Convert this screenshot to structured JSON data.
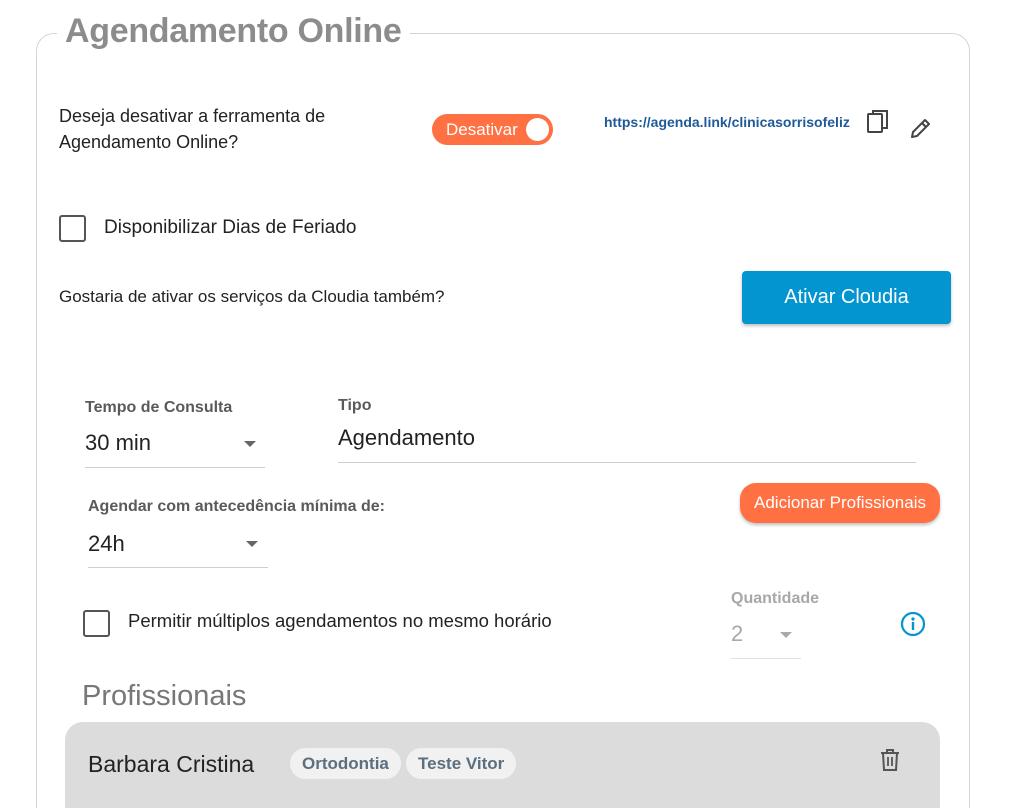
{
  "section": {
    "title": "Agendamento Online"
  },
  "disable_tool": {
    "question": "Deseja desativar a ferramenta de Agendamento Online?",
    "toggle_label": "Desativar",
    "link": "https://agenda.link/clinicasorrisofeliz"
  },
  "holidays": {
    "label": "Disponibilizar Dias de Feriado",
    "checked": false
  },
  "cloudia": {
    "question": "Gostaria de ativar os serviços da Cloudia também?",
    "button_label": "Ativar Cloudia"
  },
  "consulta": {
    "tempo_label": "Tempo de Consulta",
    "tempo_value": "30 min",
    "tipo_label": "Tipo",
    "tipo_value": "Agendamento"
  },
  "antecedencia": {
    "label": "Agendar com antecedência mínima de:",
    "value": "24h"
  },
  "add_prof_button": "Adicionar Profissionais",
  "multiplos": {
    "label": "Permitir múltiplos agendamentos no mesmo horário",
    "checked": false,
    "quantidade_label": "Quantidade",
    "quantidade_value": "2"
  },
  "profissionais": {
    "title": "Profissionais",
    "items": [
      {
        "name": "Barbara Cristina",
        "tags": [
          "Ortodontia",
          "Teste Vitor"
        ]
      }
    ]
  },
  "colors": {
    "accent_orange": "#ff7043",
    "accent_blue": "#0295cf",
    "link_blue": "#1e5a99"
  },
  "icons": {
    "copy": "copy-icon",
    "edit": "pencil-icon",
    "info": "info-icon",
    "delete": "trash-icon"
  }
}
